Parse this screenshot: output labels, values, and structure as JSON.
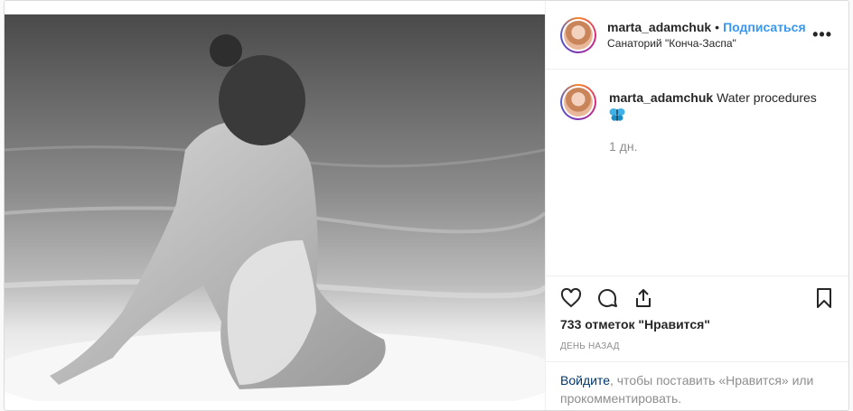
{
  "post": {
    "author": {
      "username": "marta_adamchuk",
      "follow_label": "Подписаться",
      "location": "Санаторий \"Конча-Заспа\""
    },
    "more_icon": "more-options-icon",
    "caption": {
      "username": "marta_adamchuk",
      "text": "Water procedures",
      "emoji_icon": "butterfly-icon",
      "time": "1 дн."
    },
    "actions": {
      "icons": [
        "like-heart-icon",
        "comment-icon",
        "share-icon",
        "bookmark-icon"
      ]
    },
    "likes_text": "733 отметок \"Нравится\"",
    "date_text": "ДЕНЬ НАЗАД",
    "login_prompt": {
      "link": "Войдите",
      "rest": ", чтобы поставить «Нравится» или прокомментировать."
    },
    "colors": {
      "follow": "#3897f0",
      "link": "#00376b",
      "muted": "#8e8e8e"
    }
  }
}
